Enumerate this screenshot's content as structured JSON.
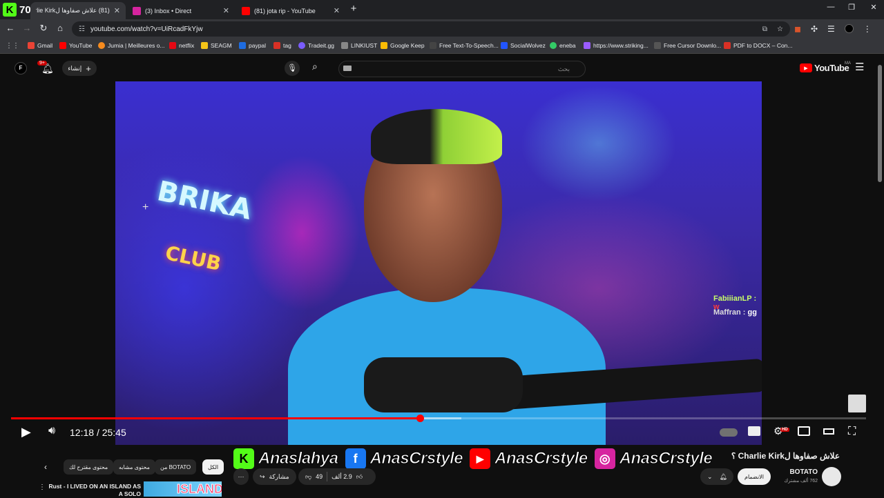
{
  "overlay_badge": {
    "letter": "K",
    "count": "70"
  },
  "tabs": [
    {
      "title": "(81) علاش صفاوها لCharlie Kirk",
      "color": "#ff0000",
      "active": true
    },
    {
      "title": "(3) Inbox • Direct",
      "color": "#d6249f",
      "active": false
    },
    {
      "title": "(81) jota rip - YouTube",
      "color": "#ff0000",
      "active": false
    }
  ],
  "new_tab_label": "+",
  "window_controls": {
    "minimize": "—",
    "restore": "❐",
    "close": "✕"
  },
  "nav": {
    "back": "←",
    "forward": "→",
    "reload": "↻",
    "home": "⌂"
  },
  "address": {
    "url": "youtube.com/watch?v=UiRcadFkYjw"
  },
  "bookmarks": [
    {
      "label": "Gmail",
      "color": "#ea4335"
    },
    {
      "label": "YouTube",
      "color": "#ff0000"
    },
    {
      "label": "Jumia | Meilleures o...",
      "color": "#f68b1e"
    },
    {
      "label": "netflix",
      "color": "#e50914"
    },
    {
      "label": "SEAGM",
      "color": "#f5c518"
    },
    {
      "label": "paypal",
      "color": "#1e6ce0"
    },
    {
      "label": "tag",
      "color": "#d93025"
    },
    {
      "label": "Tradeit.gg",
      "color": "#7a5cff"
    },
    {
      "label": "LINKIUST",
      "color": "#888888"
    },
    {
      "label": "Google Keep",
      "color": "#fbbc04"
    },
    {
      "label": "Free Text-To-Speech...",
      "color": "#444444"
    },
    {
      "label": "SocialWolvez",
      "color": "#2255ff"
    },
    {
      "label": "eneba",
      "color": "#33cc66"
    },
    {
      "label": "https://www.striking...",
      "color": "#9b5cff"
    },
    {
      "label": "Free Cursor Downlo...",
      "color": "#555555"
    },
    {
      "label": "PDF to DOCX – Con...",
      "color": "#d93025"
    }
  ],
  "yt_header": {
    "avatar_letter": "F",
    "notifications": "9+",
    "create_label": "إنشاء",
    "search_placeholder": "بحث",
    "logo_text": "YouTube",
    "region": "MA"
  },
  "video": {
    "neon_sign_top": "BRIKA",
    "neon_sign_bottom": "CLUB",
    "chat": [
      {
        "user": "FabiiianLP :",
        "message": "w"
      },
      {
        "user": "Maffran :",
        "message": "gg"
      }
    ]
  },
  "player": {
    "current_time": "12:18",
    "separator": "/",
    "duration": "25:45",
    "progress_fraction": 0.478,
    "buffer_fraction": 0.527,
    "hd_badge": "HD"
  },
  "socials": [
    {
      "icon": "K",
      "handle": "Anaslahya",
      "color": "#53fc18"
    },
    {
      "icon": "f",
      "handle": "AnasCrstyle",
      "color": "#1877f2"
    },
    {
      "icon": "▶",
      "handle": "AnasCrstyle",
      "color": "#ff0000"
    },
    {
      "icon": "◎",
      "handle": "AnasCrstyle",
      "color": "#d6249f"
    }
  ],
  "video_title": "علاش صفاوها لCharlie Kirk ؟",
  "channel": {
    "name": "BOTATO",
    "subscribers": "762 ألف مشترك",
    "join_label": "الانضمام"
  },
  "actions": {
    "likes": "2.9 ألف",
    "dislikes": "49",
    "share": "مشاركة",
    "more": "⋯"
  },
  "chips": [
    "الكل",
    "من BOTATO",
    "محتوى مشابه",
    "محتوى مقترح لك"
  ],
  "recommended": {
    "title": "Rust - I LIVED ON AN ISLAND AS A SOLO",
    "thumb_text": "ISLAND"
  }
}
